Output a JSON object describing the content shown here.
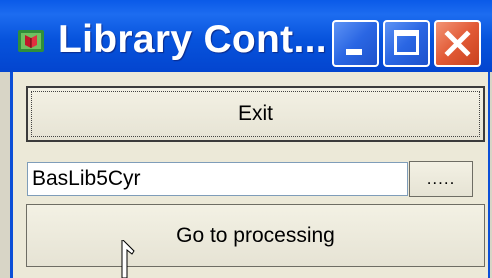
{
  "window": {
    "title": "Library Cont...",
    "icons": {
      "app": "library-book-icon",
      "minimize": "minimize-icon",
      "maximize": "maximize-icon",
      "close": "close-icon"
    }
  },
  "main": {
    "exit_label": "Exit",
    "library_field": {
      "value": "BasLib5Cyr"
    },
    "browse_label": ".....",
    "process_label": "Go to processing"
  },
  "colors": {
    "titlebar": "#0753dc",
    "close_button": "#e25a36",
    "panel": "#ece9d8"
  }
}
